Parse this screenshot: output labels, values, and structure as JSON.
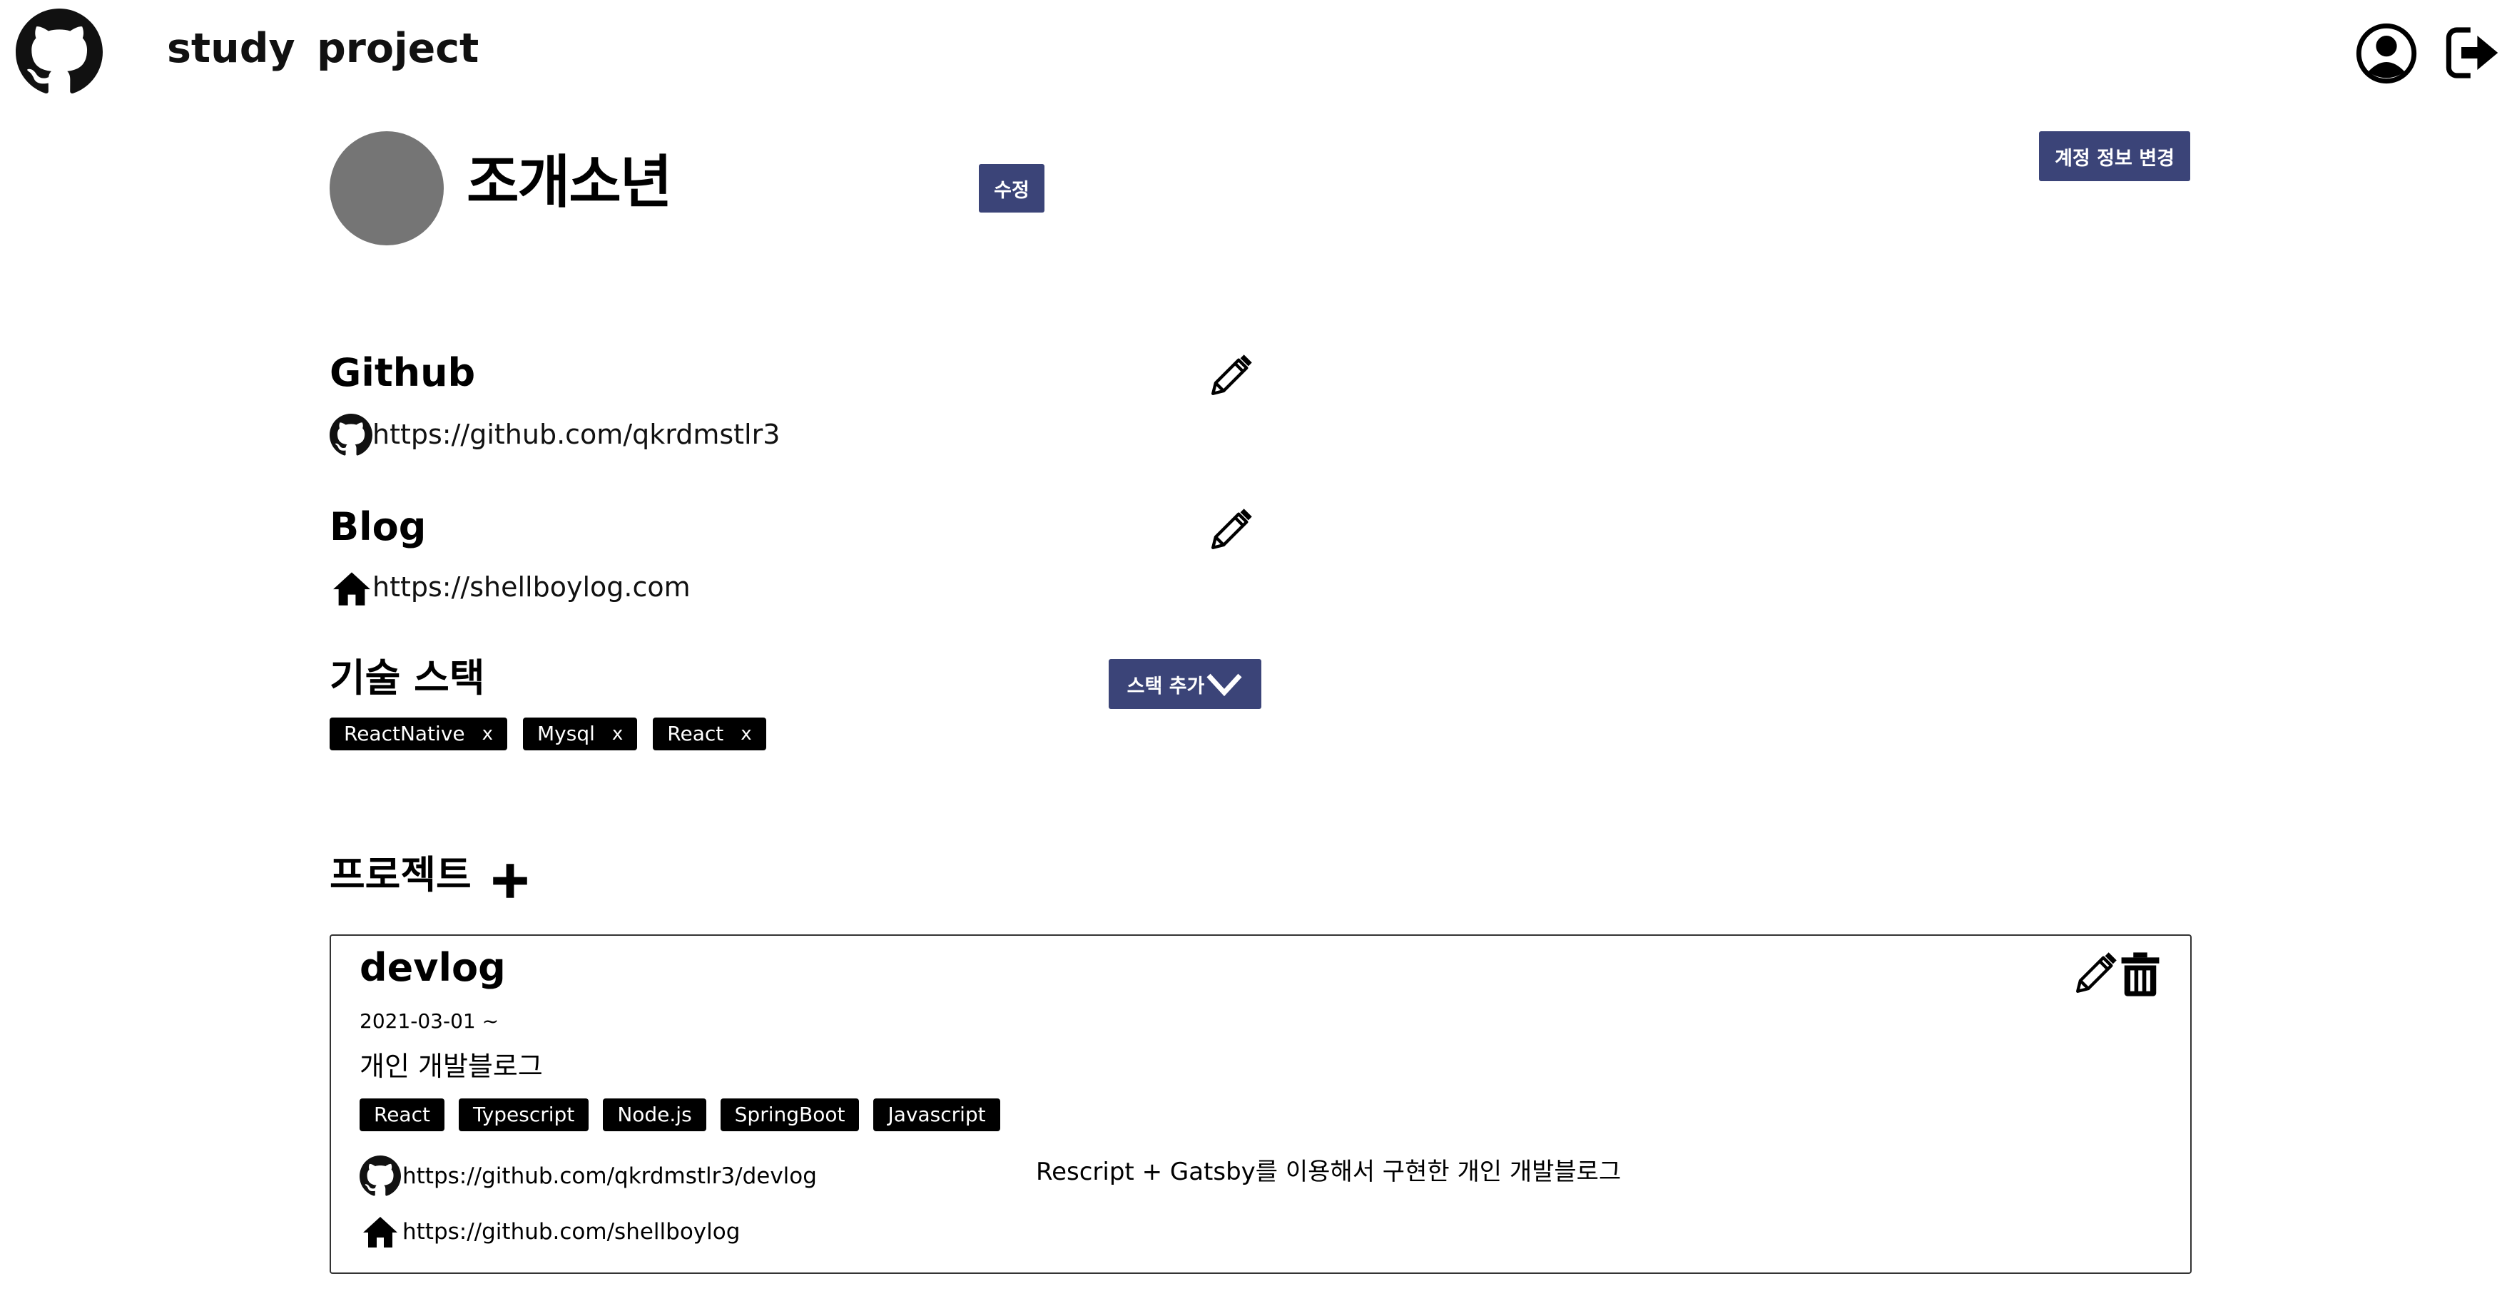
{
  "nav": {
    "links": [
      "study",
      "project"
    ]
  },
  "profile": {
    "name": "조개소년",
    "edit_label": "수정",
    "account_label": "계정 정보 변경"
  },
  "github": {
    "title": "Github",
    "url": "https://github.com/qkrdmstlr3"
  },
  "blog": {
    "title": "Blog",
    "url": "https://shellboylog.com"
  },
  "stack": {
    "title": "기술 스택",
    "add_label": "스택 추가",
    "remove_label": "x",
    "items": [
      "ReactNative",
      "Mysql",
      "React"
    ]
  },
  "projects": {
    "title": "프로젝트",
    "items": [
      {
        "title": "devlog",
        "date": "2021-03-01 ~",
        "summary": "개인 개발블로그",
        "tags": [
          "React",
          "Typescript",
          "Node.js",
          "SpringBoot",
          "Javascript"
        ],
        "github": "https://github.com/qkrdmstlr3/devlog",
        "home": "https://github.com/shellboylog",
        "description": "Rescript + Gatsby를 이용해서 구현한 개인 개발블로그"
      }
    ]
  },
  "icons": {
    "logo": "github-logo-icon",
    "user": "user-circle-icon",
    "logout": "logout-icon",
    "edit": "pencil-icon",
    "delete": "trash-icon",
    "home": "home-icon",
    "add": "plus-icon",
    "dropdown": "chevron-down-icon"
  },
  "colors": {
    "accent": "#3b4478",
    "avatar": "#757575",
    "tag_bg": "#000000"
  }
}
